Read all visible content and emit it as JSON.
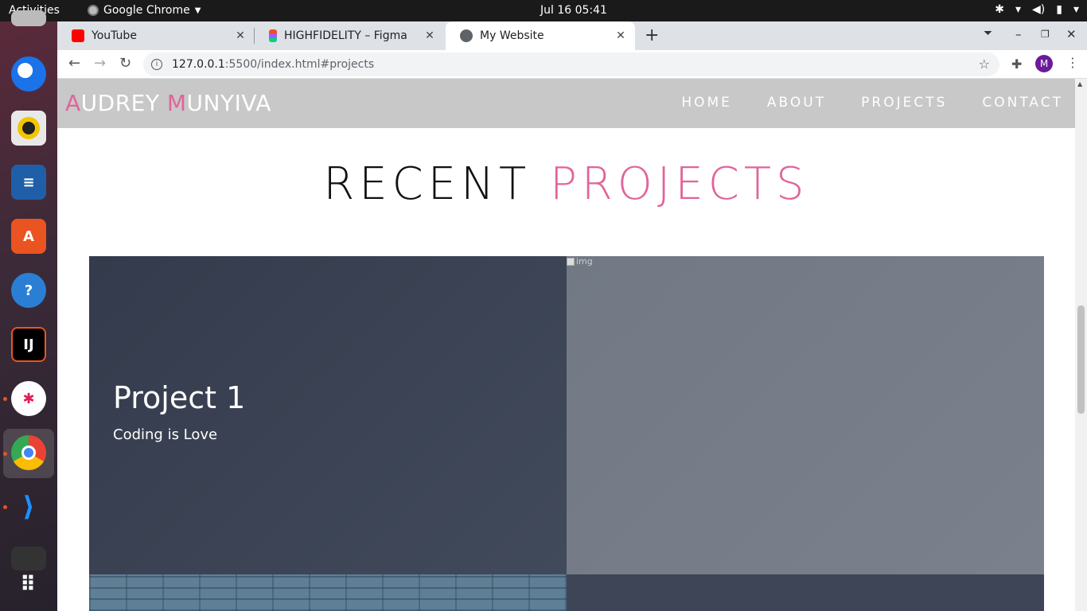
{
  "topbar": {
    "activities": "Activities",
    "app_name": "Google Chrome",
    "clock": "Jul 16  05:41"
  },
  "dock": {
    "apps": [
      {
        "name": "thunderbird",
        "icon": "mail-icon"
      },
      {
        "name": "rhythmbox",
        "icon": "speaker-icon"
      },
      {
        "name": "writer",
        "icon": "document-icon"
      },
      {
        "name": "software",
        "icon": "store-icon"
      },
      {
        "name": "help",
        "icon": "help-icon"
      },
      {
        "name": "intellij",
        "icon": "ide-icon"
      },
      {
        "name": "slack",
        "icon": "slack-icon"
      },
      {
        "name": "chrome",
        "icon": "chrome-icon"
      },
      {
        "name": "vscode",
        "icon": "code-icon"
      },
      {
        "name": "show-apps",
        "icon": "grid-icon"
      }
    ]
  },
  "browser": {
    "tabs": [
      {
        "title": "YouTube",
        "favicon_color": "#ff0000"
      },
      {
        "title": "HIGHFIDELITY – Figma",
        "favicon_color": "#a259ff"
      },
      {
        "title": "My Website",
        "favicon_color": "#5f6368"
      }
    ],
    "url_host": "127.0.0.1",
    "url_path": ":5500/index.html#projects",
    "profile_initial": "M"
  },
  "site": {
    "brand_first_initial": "A",
    "brand_first_rest": "UDREY ",
    "brand_last_initial": "M",
    "brand_last_rest": "UNYIVA",
    "nav": [
      "HOME",
      "ABOUT",
      "PROJECTS",
      "CONTACT"
    ],
    "section_title_a": "RECENT ",
    "section_title_b": "PROJECTS",
    "projects": [
      {
        "title": "Project 1",
        "subtitle": "Coding is Love"
      }
    ],
    "broken_image_alt": "img"
  },
  "colors": {
    "accent_pink": "#e0649a",
    "nav_bg": "#c8c8c8",
    "card_dark": "#3b4254"
  }
}
